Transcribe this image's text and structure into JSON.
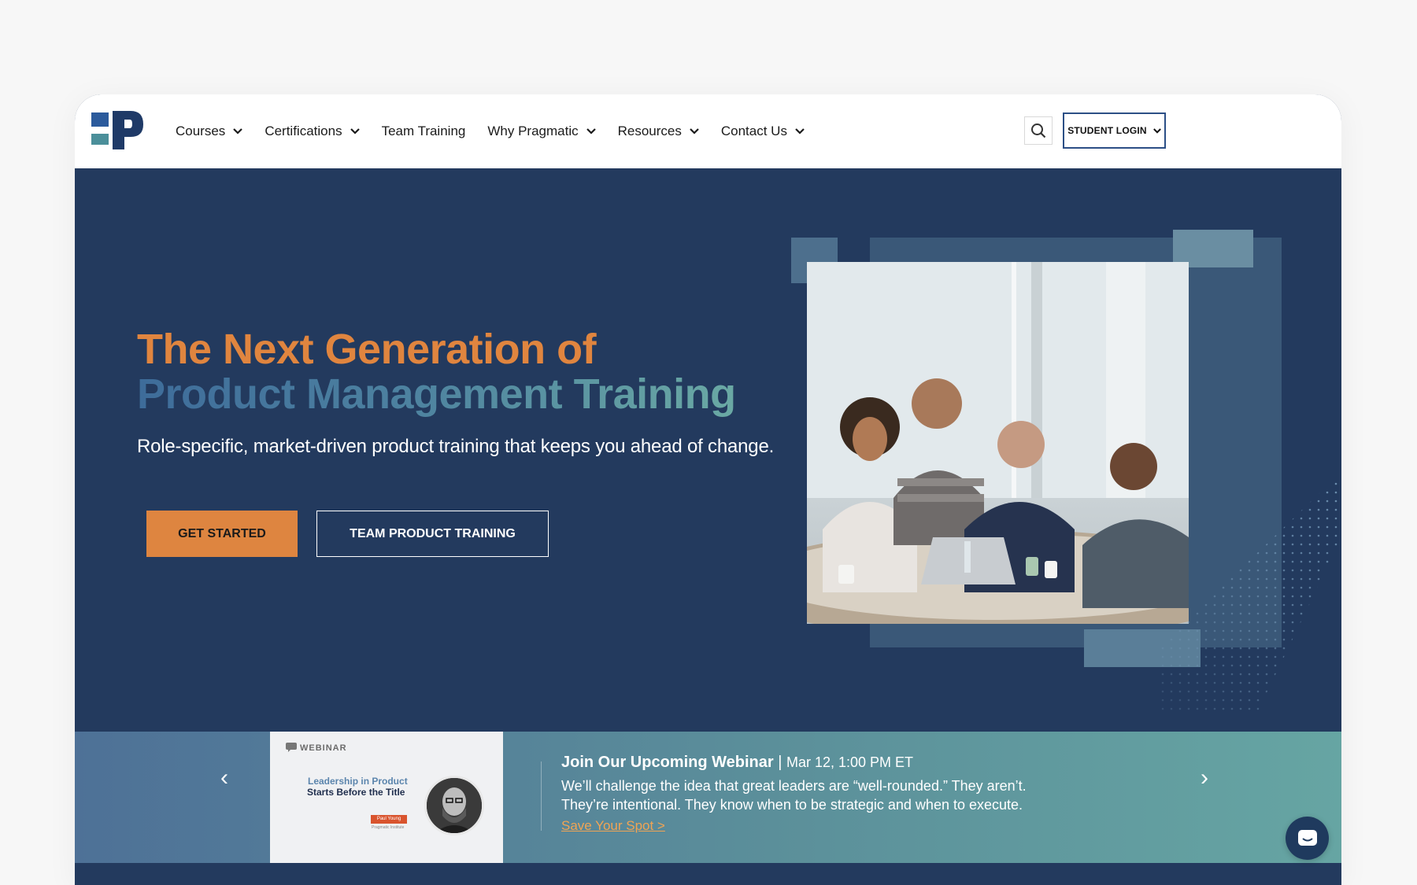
{
  "nav": {
    "items": [
      {
        "label": "Courses",
        "dropdown": true
      },
      {
        "label": "Certifications",
        "dropdown": true
      },
      {
        "label": "Team Training",
        "dropdown": false
      },
      {
        "label": "Why Pragmatic",
        "dropdown": true
      },
      {
        "label": "Resources",
        "dropdown": true
      },
      {
        "label": "Contact Us",
        "dropdown": true
      }
    ],
    "login_label": "STUDENT LOGIN"
  },
  "hero": {
    "title_line1": "The Next Generation of",
    "title_line2": "Product Management Training",
    "subtitle": "Role-specific, market-driven product training that keeps you ahead of change.",
    "primary_button": "GET STARTED",
    "secondary_button": "TEAM PRODUCT TRAINING"
  },
  "webinar": {
    "thumb_label": "WEBINAR",
    "thumb_line1": "Leadership in Product",
    "thumb_line2": "Starts Before the Title",
    "thumb_tag": "Paul Young",
    "thumb_org": "Pragmatic Institute",
    "heading": "Join Our Upcoming Webinar",
    "separator": " | ",
    "date": "Mar 12, 1:00 PM ET",
    "description": "We’ll challenge the idea that great leaders are “well-rounded.” They aren’t. They’re intentional. They know when to be strategic and when to execute.",
    "link": "Save Your Spot >",
    "prev": "‹",
    "next": "›"
  },
  "colors": {
    "navy": "#233a5e",
    "orange": "#de8540",
    "teal": "#66a5a3"
  }
}
